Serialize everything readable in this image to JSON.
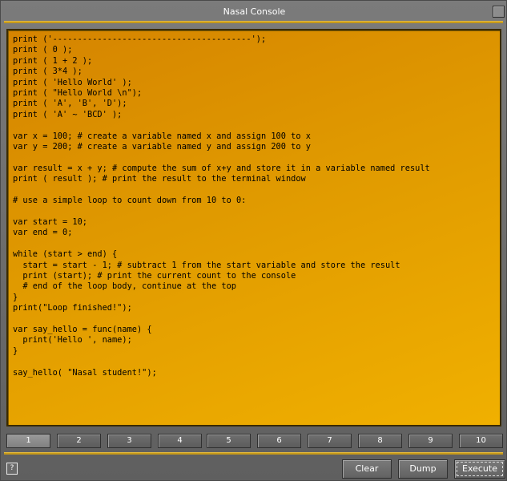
{
  "window": {
    "title": "Nasal Console"
  },
  "editor": {
    "lines": [
      "print ('----------------------------------------');",
      "print ( 0 );",
      "print ( 1 + 2 );",
      "print ( 3*4 );",
      "print ( 'Hello World' );",
      "print ( \"Hello World \\n\");",
      "print ( 'A', 'B', 'D');",
      "print ( 'A' ~ 'BCD' );",
      "",
      "var x = 100; # create a variable named x and assign 100 to x",
      "var y = 200; # create a variable named y and assign 200 to y",
      "",
      "var result = x + y; # compute the sum of x+y and store it in a variable named result",
      "print ( result ); # print the result to the terminal window",
      "",
      "# use a simple loop to count down from 10 to 0:",
      "",
      "var start = 10;",
      "var end = 0;",
      "",
      "while (start > end) {",
      "  start = start - 1; # subtract 1 from the start variable and store the result",
      "  print (start); # print the current count to the console",
      "  # end of the loop body, continue at the top",
      "}",
      "print(\"Loop finished!\");",
      "",
      "var say_hello = func(name) {",
      "  print('Hello ', name);",
      "}",
      "",
      "say_hello( \"Nasal student!\");"
    ]
  },
  "tabs": [
    "1",
    "2",
    "3",
    "4",
    "5",
    "6",
    "7",
    "8",
    "9",
    "10"
  ],
  "toolbar": {
    "help": "?",
    "clear": "Clear",
    "dump": "Dump",
    "execute": "Execute"
  }
}
